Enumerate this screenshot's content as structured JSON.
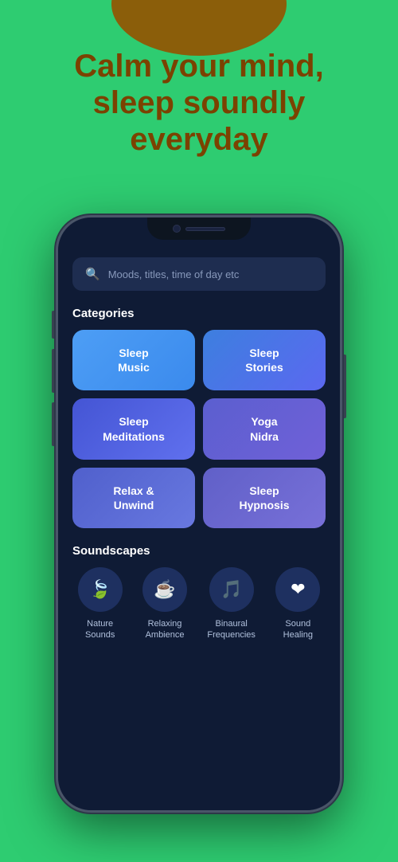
{
  "app": {
    "background_color": "#2ecc71"
  },
  "hero": {
    "title": "Calm your mind, sleep soundly everyday"
  },
  "phone": {
    "search": {
      "placeholder": "Moods, titles, time of day etc"
    },
    "categories_title": "Categories",
    "categories": [
      {
        "id": "sleep-music",
        "label": "Sleep\nMusic",
        "style": "card-blue-light"
      },
      {
        "id": "sleep-stories",
        "label": "Sleep\nStories",
        "style": "card-blue-medium"
      },
      {
        "id": "sleep-meditations",
        "label": "Sleep\nMeditations",
        "style": "card-blue-dark"
      },
      {
        "id": "yoga-nidra",
        "label": "Yoga\nNidra",
        "style": "card-purple"
      },
      {
        "id": "relax-unwind",
        "label": "Relax &\nUnwind",
        "style": "card-indigo"
      },
      {
        "id": "sleep-hypnosis",
        "label": "Sleep\nHypnosis",
        "style": "card-violet"
      }
    ],
    "soundscapes_title": "Soundscapes",
    "soundscapes": [
      {
        "id": "nature-sounds",
        "label": "Nature\nSounds",
        "icon": "🍃"
      },
      {
        "id": "relaxing-ambience",
        "label": "Relaxing\nAmbience",
        "icon": "☕"
      },
      {
        "id": "binaural-frequencies",
        "label": "Binaural\nFrequencies",
        "icon": "🎵"
      },
      {
        "id": "sound-healing",
        "label": "Sound\nHealing",
        "icon": "❤"
      }
    ]
  }
}
